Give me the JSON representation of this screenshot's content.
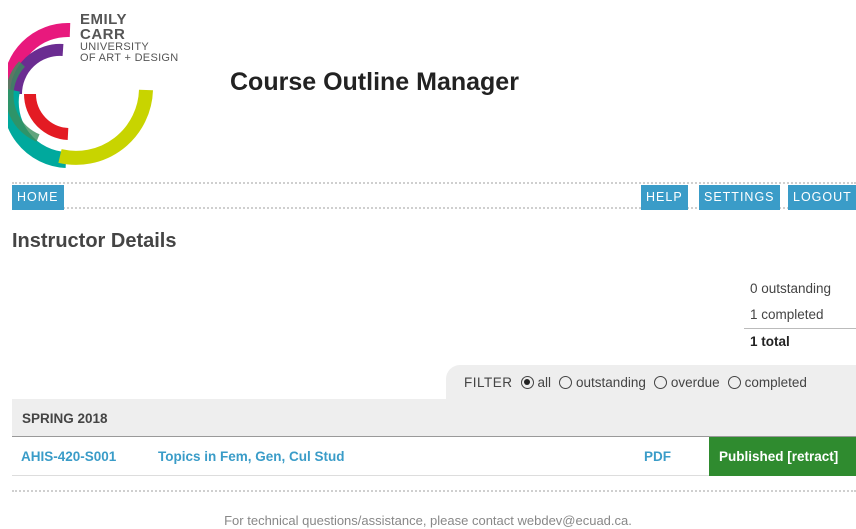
{
  "logo": {
    "line1": "EMILY",
    "line2": "CARR",
    "line3": "UNIVERSITY",
    "line4": "OF ART + DESIGN",
    "colors": [
      "#e8197d",
      "#6b2c91",
      "#00a99d",
      "#c8d400",
      "#e31b23"
    ]
  },
  "header": {
    "title": "Course Outline Manager"
  },
  "nav": {
    "home": "HOME",
    "help": "HELP",
    "settings": "SETTINGS",
    "logout": "LOGOUT",
    "color": "#3a9cc8"
  },
  "main": {
    "section_title": "Instructor Details",
    "summary": {
      "outstanding": "0 outstanding",
      "completed": "1 completed",
      "total": "1 total"
    },
    "filter": {
      "label": "FILTER",
      "options": [
        {
          "label": "all",
          "checked": true
        },
        {
          "label": "outstanding",
          "checked": false
        },
        {
          "label": "overdue",
          "checked": false
        },
        {
          "label": "completed",
          "checked": false
        }
      ]
    },
    "term": "SPRING 2018",
    "courses": [
      {
        "code": "AHIS-420-S001",
        "name": "Topics in Fem, Gen, Cul Stud",
        "pdf": "PDF",
        "status": "Published [retract]",
        "status_color": "#2f8b2f"
      }
    ]
  },
  "footer": {
    "text": "For technical questions/assistance, please contact webdev@ecuad.ca."
  }
}
